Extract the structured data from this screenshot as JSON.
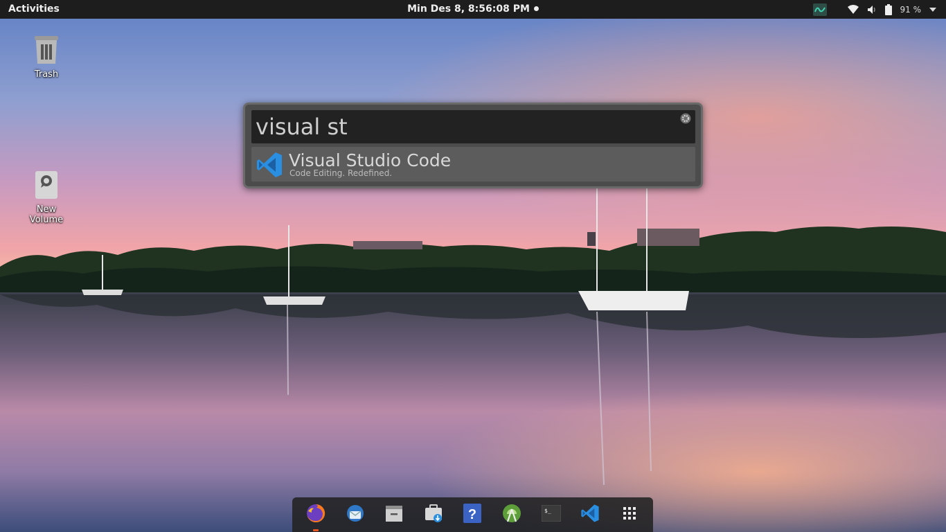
{
  "topbar": {
    "activities": "Activities",
    "clock": "Min Des  8,  8:56:08 PM",
    "battery_percent": "91 %"
  },
  "desktop": {
    "icons": [
      {
        "label": "Trash",
        "icon": "trash-icon"
      },
      {
        "label": "New\nVolume",
        "icon": "drive-icon"
      }
    ]
  },
  "launcher": {
    "query": "visual st",
    "result": {
      "title": "Visual Studio Code",
      "description": "Code Editing. Redefined.",
      "icon": "vscode-icon"
    }
  },
  "dock": {
    "items": [
      {
        "name": "firefox",
        "icon": "firefox-icon",
        "running": true
      },
      {
        "name": "thunderbird",
        "icon": "thunderbird-icon",
        "running": false
      },
      {
        "name": "files",
        "icon": "files-icon",
        "running": false
      },
      {
        "name": "software",
        "icon": "software-center-icon",
        "running": false
      },
      {
        "name": "help",
        "icon": "help-icon",
        "running": false
      },
      {
        "name": "android-studio",
        "icon": "android-studio-icon",
        "running": false
      },
      {
        "name": "terminal",
        "icon": "terminal-icon",
        "running": false
      },
      {
        "name": "vscode",
        "icon": "vscode-icon",
        "running": false
      },
      {
        "name": "app-grid",
        "icon": "app-grid-icon",
        "running": false
      }
    ]
  },
  "colors": {
    "topbar_bg": "#1d1d1d",
    "accent": "#e95420",
    "vscode_blue": "#2a8fe0"
  }
}
